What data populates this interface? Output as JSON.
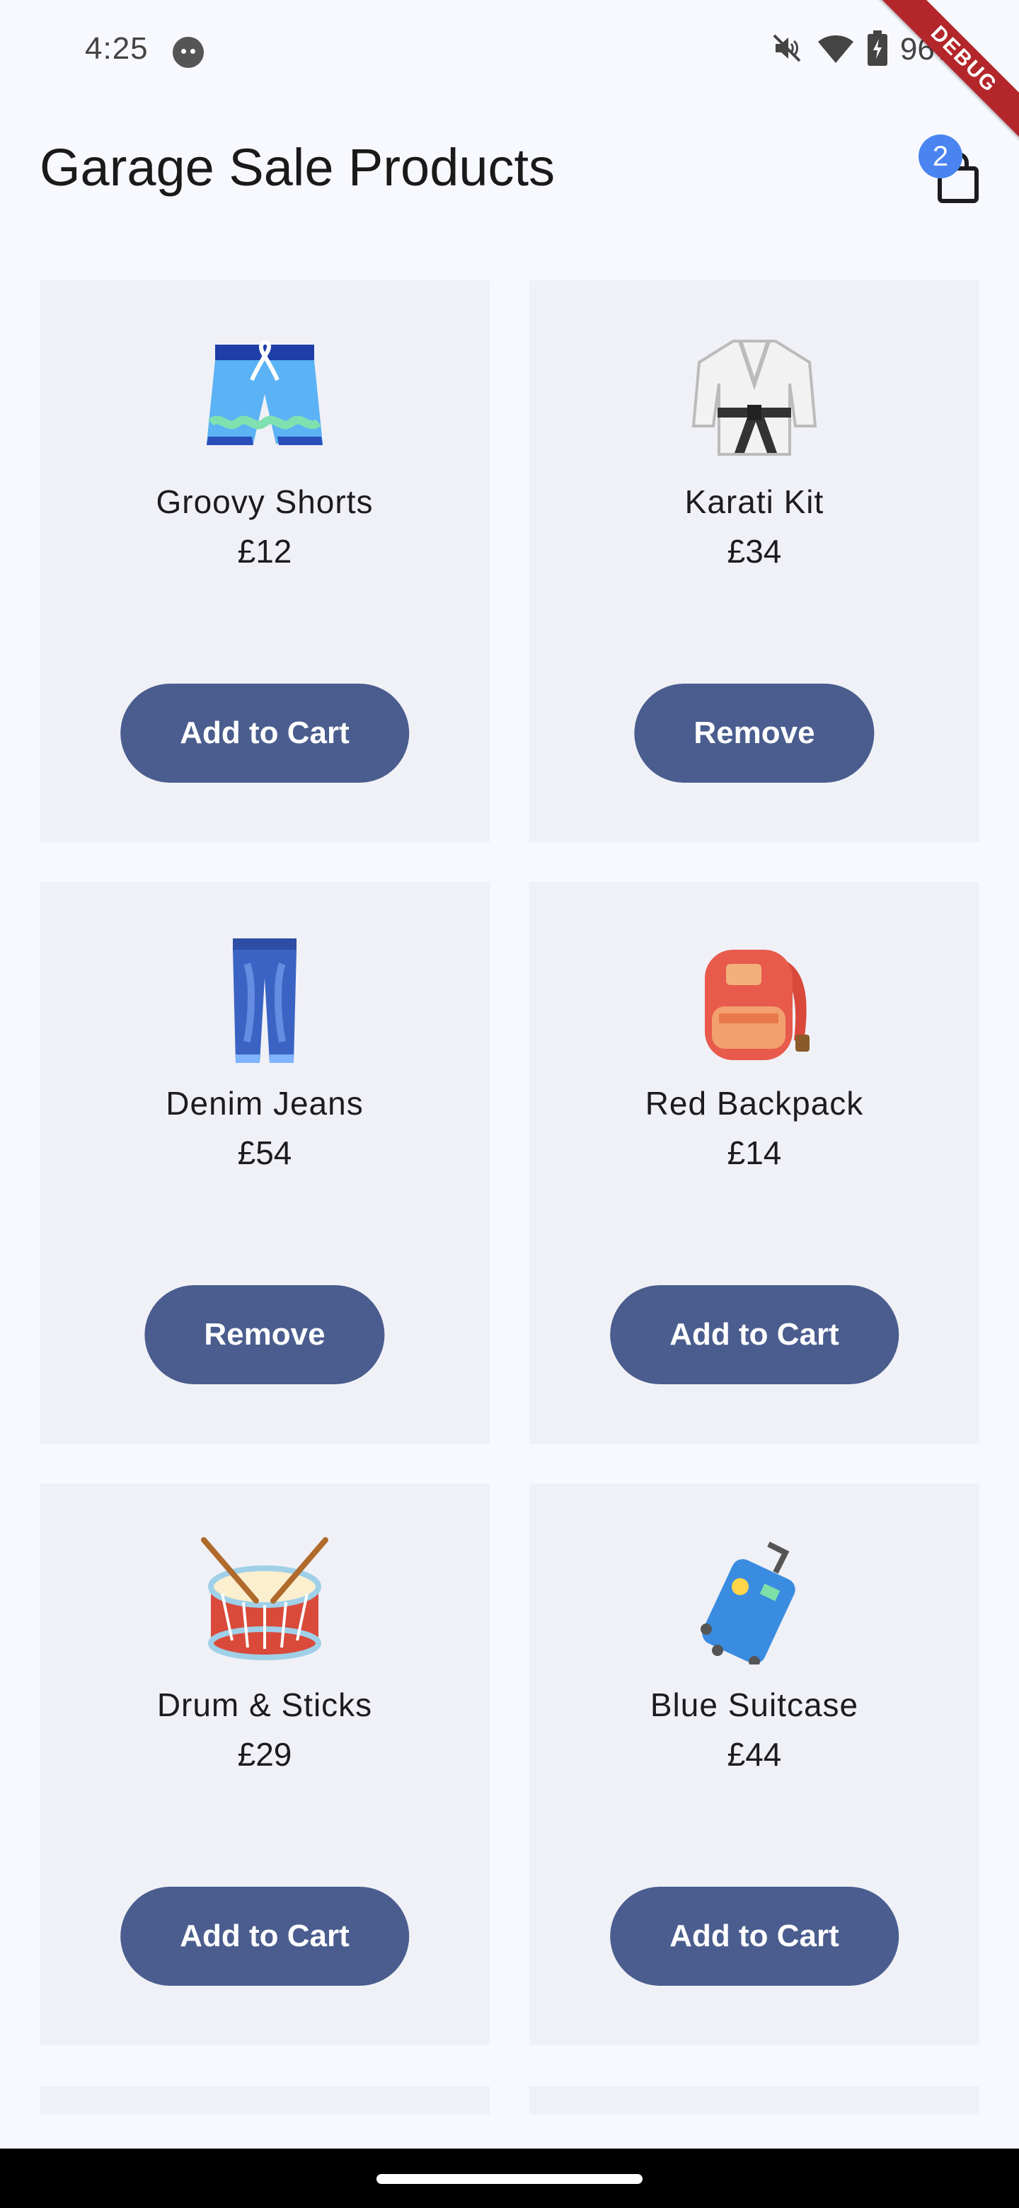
{
  "status_bar": {
    "time": "4:25",
    "battery": "96%",
    "icons": [
      "app-notification-icon",
      "mute-icon",
      "wifi-icon",
      "battery-charging-icon"
    ]
  },
  "debug_banner": "DEBUG",
  "app_bar": {
    "title": "Garage Sale Products",
    "cart_count": "2",
    "cart_icon": "shopping-bag-icon"
  },
  "products": [
    {
      "name": "Groovy Shorts",
      "price": "£12",
      "button": "Add to Cart",
      "icon": "shorts-icon"
    },
    {
      "name": "Karati Kit",
      "price": "£34",
      "button": "Remove",
      "icon": "martial-arts-uniform-icon"
    },
    {
      "name": "Denim Jeans",
      "price": "£54",
      "button": "Remove",
      "icon": "jeans-icon"
    },
    {
      "name": "Red Backpack",
      "price": "£14",
      "button": "Add to Cart",
      "icon": "backpack-icon"
    },
    {
      "name": "Drum & Sticks",
      "price": "£29",
      "button": "Add to Cart",
      "icon": "drum-icon"
    },
    {
      "name": "Blue Suitcase",
      "price": "£44",
      "button": "Add to Cart",
      "icon": "suitcase-icon"
    }
  ],
  "colors": {
    "background": "#f8f9fe",
    "card": "#f0f1f7",
    "button": "#4a5d8e",
    "badge": "#4a84f0",
    "debug": "#b3262a"
  }
}
